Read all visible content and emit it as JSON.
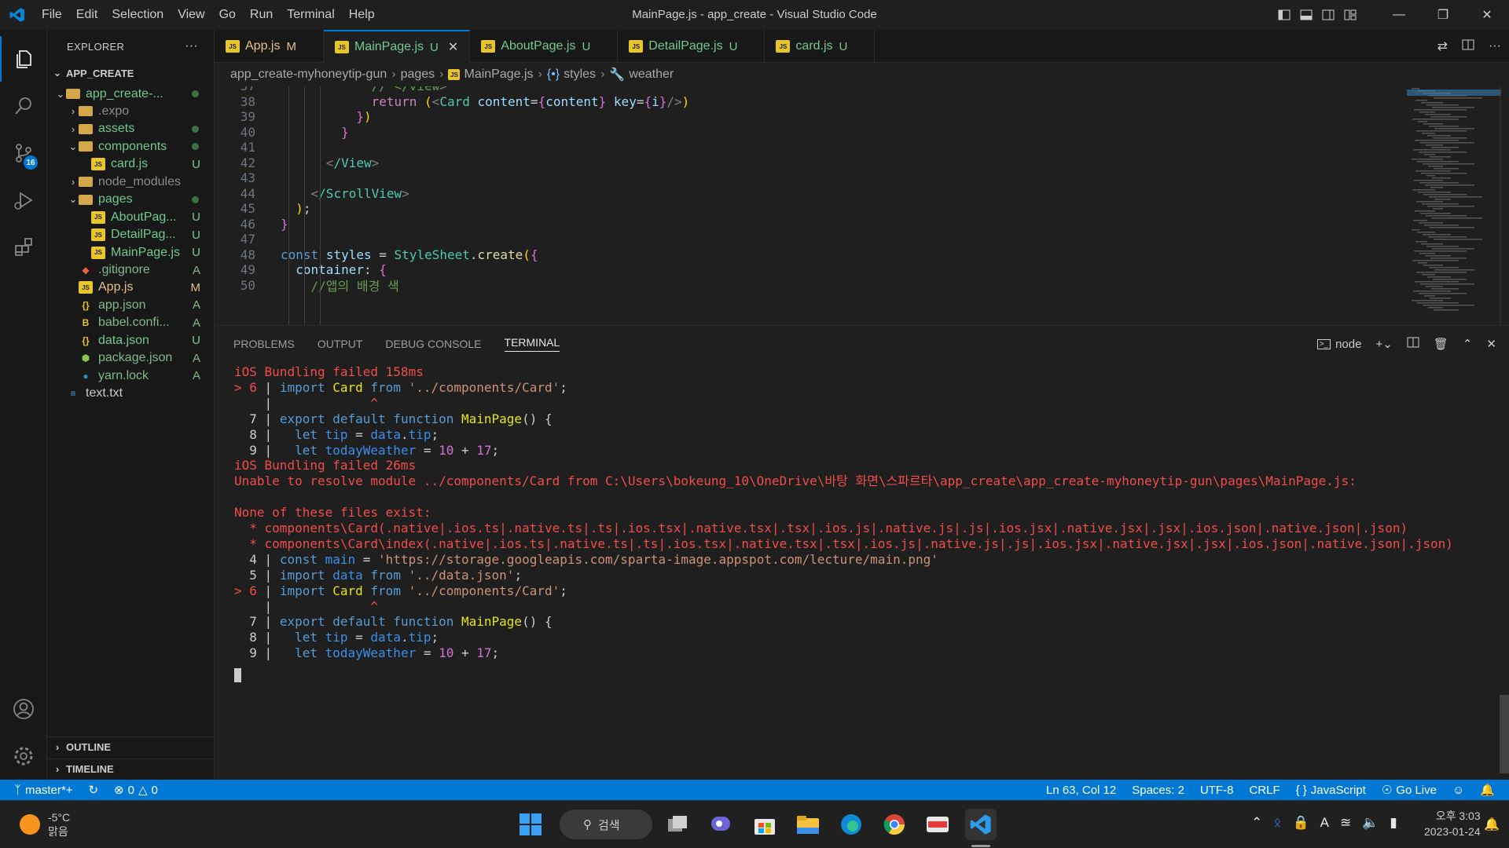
{
  "window": {
    "title": "MainPage.js - app_create - Visual Studio Code"
  },
  "menu": [
    "File",
    "Edit",
    "Selection",
    "View",
    "Go",
    "Run",
    "Terminal",
    "Help"
  ],
  "activity": {
    "scm_badge": "16"
  },
  "explorer": {
    "header": "EXPLORER",
    "more": "···",
    "root": "APP_CREATE",
    "items": [
      {
        "name": "app_create-...",
        "status": "",
        "indent": 1,
        "kind": "folder-open"
      },
      {
        "name": ".expo",
        "status": "",
        "indent": 2,
        "kind": "folder"
      },
      {
        "name": "assets",
        "status": "",
        "indent": 2,
        "kind": "folder"
      },
      {
        "name": "components",
        "status": "",
        "indent": 2,
        "kind": "folder-open"
      },
      {
        "name": "card.js",
        "status": "U",
        "indent": 3,
        "kind": "js"
      },
      {
        "name": "node_modules",
        "status": "",
        "indent": 2,
        "kind": "folder"
      },
      {
        "name": "pages",
        "status": "",
        "indent": 2,
        "kind": "folder-open"
      },
      {
        "name": "AboutPag...",
        "status": "U",
        "indent": 3,
        "kind": "js"
      },
      {
        "name": "DetailPag...",
        "status": "U",
        "indent": 3,
        "kind": "js"
      },
      {
        "name": "MainPage.js",
        "status": "U",
        "indent": 3,
        "kind": "js"
      },
      {
        "name": ".gitignore",
        "status": "A",
        "indent": 2,
        "kind": "git"
      },
      {
        "name": "App.js",
        "status": "M",
        "indent": 2,
        "kind": "js"
      },
      {
        "name": "app.json",
        "status": "A",
        "indent": 2,
        "kind": "json"
      },
      {
        "name": "babel.confi...",
        "status": "A",
        "indent": 2,
        "kind": "babel"
      },
      {
        "name": "data.json",
        "status": "U",
        "indent": 2,
        "kind": "json"
      },
      {
        "name": "package.json",
        "status": "A",
        "indent": 2,
        "kind": "npm"
      },
      {
        "name": "yarn.lock",
        "status": "A",
        "indent": 2,
        "kind": "yarn"
      },
      {
        "name": "text.txt",
        "status": "",
        "indent": 1,
        "kind": "txt"
      }
    ],
    "outline": "OUTLINE",
    "timeline": "TIMELINE"
  },
  "tabs": [
    {
      "name": "App.js",
      "status": "M"
    },
    {
      "name": "MainPage.js",
      "status": "U",
      "active": true
    },
    {
      "name": "AboutPage.js",
      "status": "U"
    },
    {
      "name": "DetailPage.js",
      "status": "U"
    },
    {
      "name": "card.js",
      "status": "U"
    }
  ],
  "breadcrumb": [
    "app_create-myhoneytip-gun",
    "pages",
    "MainPage.js",
    "styles",
    "weather"
  ],
  "editor": {
    "lines": [
      {
        "n": "37",
        "t": "            // </View>"
      },
      {
        "n": "38",
        "t": "            return (<Card content={content} key={i}/>)"
      },
      {
        "n": "39",
        "t": "          })"
      },
      {
        "n": "40",
        "t": "        }"
      },
      {
        "n": "41",
        "t": ""
      },
      {
        "n": "42",
        "t": "      </View>"
      },
      {
        "n": "43",
        "t": ""
      },
      {
        "n": "44",
        "t": "    </ScrollView>"
      },
      {
        "n": "45",
        "t": "  );"
      },
      {
        "n": "46",
        "t": "}"
      },
      {
        "n": "47",
        "t": ""
      },
      {
        "n": "48",
        "t": "const styles = StyleSheet.create({"
      },
      {
        "n": "49",
        "t": "  container: {"
      },
      {
        "n": "50",
        "t": "    //앱의 배경 색"
      }
    ]
  },
  "panel": {
    "tabs": [
      "PROBLEMS",
      "OUTPUT",
      "DEBUG CONSOLE",
      "TERMINAL"
    ],
    "active": "TERMINAL",
    "shell": "node"
  },
  "terminal": [
    [
      [
        "iOS",
        "red"
      ],
      [
        " Bundling failed 158ms",
        "red"
      ]
    ],
    [
      [
        "> 6",
        "red"
      ],
      [
        " | ",
        "gray"
      ],
      [
        "import ",
        "kw"
      ],
      [
        "Card",
        "yel"
      ],
      [
        " from ",
        "kw"
      ],
      [
        "'../components/Card'",
        "str"
      ],
      [
        ";",
        "gray"
      ]
    ],
    [
      [
        "    |             ",
        "gray"
      ],
      [
        "^",
        "red"
      ]
    ],
    [
      [
        "  7",
        "gray"
      ],
      [
        " | ",
        "gray"
      ],
      [
        "export default function ",
        "kw"
      ],
      [
        "MainPage",
        "yel"
      ],
      [
        "() {",
        "gray"
      ]
    ],
    [
      [
        "  8",
        "gray"
      ],
      [
        " |   ",
        "gray"
      ],
      [
        "let ",
        "kw"
      ],
      [
        "tip",
        "blue"
      ],
      [
        " = ",
        "gray"
      ],
      [
        "data",
        "blue"
      ],
      [
        ".",
        "gray"
      ],
      [
        "tip",
        "blue"
      ],
      [
        ";",
        "gray"
      ]
    ],
    [
      [
        "  9",
        "gray"
      ],
      [
        " |   ",
        "gray"
      ],
      [
        "let ",
        "kw"
      ],
      [
        "todayWeather",
        "blue"
      ],
      [
        " = ",
        "gray"
      ],
      [
        "10",
        "mag"
      ],
      [
        " + ",
        "gray"
      ],
      [
        "17",
        "mag"
      ],
      [
        ";",
        "gray"
      ]
    ],
    [
      [
        "iOS",
        "red"
      ],
      [
        " Bundling failed 26ms",
        "red"
      ]
    ],
    [
      [
        "Unable to resolve module ../components/Card from C:\\Users\\bokeung_10\\OneDrive\\바탕 화면\\스파르타\\app_create\\app_create-myhoneytip-gun\\pages\\MainPage.js:",
        "red"
      ]
    ],
    [
      [
        "",
        "gray"
      ]
    ],
    [
      [
        "None of these files exist:",
        "red"
      ]
    ],
    [
      [
        "  * components\\Card(.native|.ios.ts|.native.ts|.ts|.ios.tsx|.native.tsx|.tsx|.ios.js|.native.js|.js|.ios.jsx|.native.jsx|.jsx|.ios.json|.native.json|.json)",
        "red"
      ]
    ],
    [
      [
        "  * components\\Card\\index(.native|.ios.ts|.native.ts|.ts|.ios.tsx|.native.tsx|.tsx|.ios.js|.native.js|.js|.ios.jsx|.native.jsx|.jsx|.ios.json|.native.json|.json)",
        "red"
      ]
    ],
    [
      [
        "  4",
        "gray"
      ],
      [
        " | ",
        "gray"
      ],
      [
        "const ",
        "kw"
      ],
      [
        "main",
        "blue"
      ],
      [
        " = ",
        "gray"
      ],
      [
        "'https://storage.googleapis.com/sparta-image.appspot.com/lecture/main.png'",
        "str"
      ]
    ],
    [
      [
        "  5",
        "gray"
      ],
      [
        " | ",
        "gray"
      ],
      [
        "import ",
        "kw"
      ],
      [
        "data",
        "blue"
      ],
      [
        " from ",
        "kw"
      ],
      [
        "'../data.json'",
        "str"
      ],
      [
        ";",
        "gray"
      ]
    ],
    [
      [
        "> 6",
        "red"
      ],
      [
        " | ",
        "gray"
      ],
      [
        "import ",
        "kw"
      ],
      [
        "Card",
        "yel"
      ],
      [
        " from ",
        "kw"
      ],
      [
        "'../components/Card'",
        "str"
      ],
      [
        ";",
        "gray"
      ]
    ],
    [
      [
        "    |             ",
        "gray"
      ],
      [
        "^",
        "red"
      ]
    ],
    [
      [
        "  7",
        "gray"
      ],
      [
        " | ",
        "gray"
      ],
      [
        "export default function ",
        "kw"
      ],
      [
        "MainPage",
        "yel"
      ],
      [
        "() {",
        "gray"
      ]
    ],
    [
      [
        "  8",
        "gray"
      ],
      [
        " |   ",
        "gray"
      ],
      [
        "let ",
        "kw"
      ],
      [
        "tip",
        "blue"
      ],
      [
        " = ",
        "gray"
      ],
      [
        "data",
        "blue"
      ],
      [
        ".",
        "gray"
      ],
      [
        "tip",
        "blue"
      ],
      [
        ";",
        "gray"
      ]
    ],
    [
      [
        "  9",
        "gray"
      ],
      [
        " |   ",
        "gray"
      ],
      [
        "let ",
        "kw"
      ],
      [
        "todayWeather",
        "blue"
      ],
      [
        " = ",
        "gray"
      ],
      [
        "10",
        "mag"
      ],
      [
        " + ",
        "gray"
      ],
      [
        "17",
        "mag"
      ],
      [
        ";",
        "gray"
      ]
    ]
  ],
  "status": {
    "branch": "master*+",
    "errors": "0",
    "warnings": "0",
    "position": "Ln 63, Col 12",
    "spaces": "Spaces: 2",
    "encoding": "UTF-8",
    "eol": "CRLF",
    "language": "JavaScript",
    "golive": "Go Live"
  },
  "taskbar": {
    "temp": "-5°C",
    "weather": "맑음",
    "search": "검색",
    "time": "오후 3:03",
    "date": "2023-01-24"
  }
}
